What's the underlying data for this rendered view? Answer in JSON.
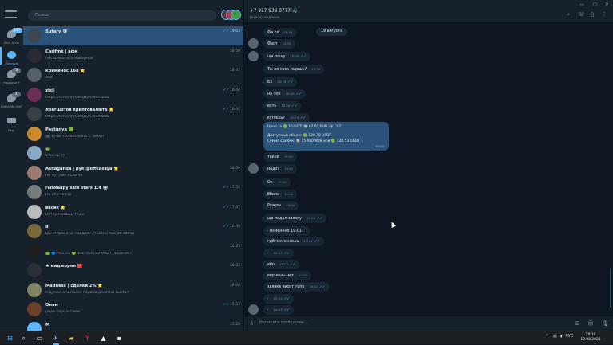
{
  "folders": {
    "items": [
      {
        "label": "Все чаты",
        "badge": "107",
        "active": false
      },
      {
        "label": "Личные",
        "badge": "",
        "active": true
      },
      {
        "label": "подарки т",
        "badge": "3",
        "active": false
      },
      {
        "label": "КАНАЛЫ НФТ",
        "badge": "1",
        "active": false
      },
      {
        "label": "Ред.",
        "badge": "",
        "active": false
      }
    ]
  },
  "search": {
    "placeholder": "Поиск"
  },
  "chats": [
    {
      "name": "Sutary 🛡",
      "preview": ".",
      "time": "19:03",
      "read": true,
      "active": true,
      "color": "#3d4754"
    },
    {
      "name": "Carifmk | афк",
      "preview": "Посидеваться наверное",
      "time": "18:59",
      "read": false,
      "color": "#262b33"
    },
    {
      "name": "криминос 168 ⭐",
      "preview": "ааа",
      "time": "18:47",
      "read": false,
      "color": "#55606b"
    },
    {
      "name": "zlxl|",
      "preview": "https://t.me/nft/GiftQxZCMSYWX6",
      "time": "18:44",
      "read": true,
      "color": "#6b2f56"
    },
    {
      "name": "лонгшотов криптовалюта ⭐",
      "preview": "https://t.me/nft/GiftQxZCMSYWX6",
      "time": "18:42",
      "read": true,
      "color": "#3a3f44"
    },
    {
      "name": "Pastunya 🟩",
      "preview": "🖼 Если что без бана ... окей?",
      "time": "",
      "read": false,
      "color": "#c88a2d"
    },
    {
      "name": "🐢",
      "preview": "Стикер 😔",
      "time": "",
      "read": false,
      "color": "#8aa8c4"
    },
    {
      "name": "Ashaganda | рук @offkasaya ⭐",
      "preview": "не тот ник если че",
      "time": "18:00",
      "read": false,
      "color": "#9d7a6e"
    },
    {
      "name": "гыбкаару sale stars 1.4 🏵",
      "preview": "Не ебу точно",
      "time": "17:51",
      "read": true,
      "color": "#777a7d"
    },
    {
      "name": "васик ⭐",
      "preview": "Ветку гонишь тоже",
      "time": "17:47",
      "read": true,
      "color": "#b9bcbf"
    },
    {
      "name": "8",
      "preview": "Вы отправили подарок стоимостью 15 звезд",
      "time": "16:46",
      "read": true,
      "color": "#7a6a3a"
    },
    {
      "name": "",
      "preview": "🟩 🔵 Чек на 🟢 150.068183 USDT ($150.06)",
      "time": "16:23",
      "read": false,
      "color": "#1f1f22"
    },
    {
      "name": "♠ маджорон 🟥",
      "preview": "",
      "time": "16:22",
      "read": false,
      "color": "#2b3038"
    },
    {
      "name": "Madness | сделки 2% ⭐",
      "preview": "я думал его после первой десятки выебет",
      "time": "16:04",
      "read": false,
      "color": "#7e8560"
    },
    {
      "name": "Онам",
      "preview": "ради сорцастами",
      "time": "15:53",
      "read": true,
      "color": "#6b3f2a"
    },
    {
      "name": "M",
      "preview": "",
      "time": "15:28",
      "read": false,
      "color": "#5eb5f7"
    }
  ],
  "header": {
    "title": "+7 917 938 0777 🎣",
    "subtitle": "был(а) недавно"
  },
  "date_pill": "19 августа",
  "messages": [
    {
      "text": "Фа се",
      "time": "18:56",
      "avatar": false
    },
    {
      "text": "Фаст",
      "time": "18:56",
      "avatar": true
    },
    {
      "text": "ща пощу",
      "time": "18:56",
      "avatar": true,
      "read": true
    },
    {
      "text": "Ты по скок ищешь?",
      "time": "18:56",
      "avatar": false
    },
    {
      "text": "83",
      "time": "18:58",
      "avatar": false,
      "read": true
    },
    {
      "text": "на тон",
      "time": "18:58",
      "avatar": false,
      "read": true
    },
    {
      "text": "есть",
      "time": "18:58",
      "avatar": false,
      "read": true
    },
    {
      "text": "купишь?",
      "time": "18:58",
      "avatar": false,
      "read": true
    },
    {
      "text": "такой",
      "time": "19:00",
      "avatar": false
    },
    {
      "text": "надо?",
      "time": "19:00",
      "avatar": true
    },
    {
      "text": "Ок",
      "time": "19:00",
      "avatar": false
    },
    {
      "text": "Ебала",
      "time": "19:00",
      "avatar": false
    },
    {
      "text": "Рожры",
      "time": "19:00",
      "avatar": false
    },
    {
      "text": "ща подал заявку",
      "time": "19:00",
      "avatar": false,
      "read": true
    },
    {
      "text": "· изменено 19:01",
      "time": "",
      "avatar": false
    },
    {
      "text": "гдб чек оснешь",
      "time": "19:01",
      "avatar": false,
      "read": true
    },
    {
      "text": "·",
      "time": "19:02",
      "avatar": false,
      "read": true
    },
    {
      "text": "або",
      "time": "19:02",
      "avatar": false,
      "read": true
    },
    {
      "text": "вернешь-нет",
      "time": "19:02",
      "avatar": false
    },
    {
      "text": "заявка висит тупо",
      "time": "19:02",
      "avatar": false,
      "read": true
    },
    {
      "text": "·",
      "time": "19:02",
      "avatar": false,
      "read": true
    },
    {
      "text": "·",
      "time": "19:03",
      "avatar": true,
      "read": true
    }
  ],
  "offer": {
    "line1": "Цена за 🟢 1 USDT: 🔘 82.97 RUB - $1.02",
    "line2": "Доступный объем: 🟢 120.78 USDT",
    "line3": "Сумма сделки: 🔘 15 000 RUB или 🟢 120.53 USDT",
    "time": "19:00"
  },
  "composer": {
    "placeholder": "Написать сообщение..."
  },
  "taskbar": {
    "lang": "РУС",
    "time": "19:10",
    "date": "19.08.2025"
  }
}
